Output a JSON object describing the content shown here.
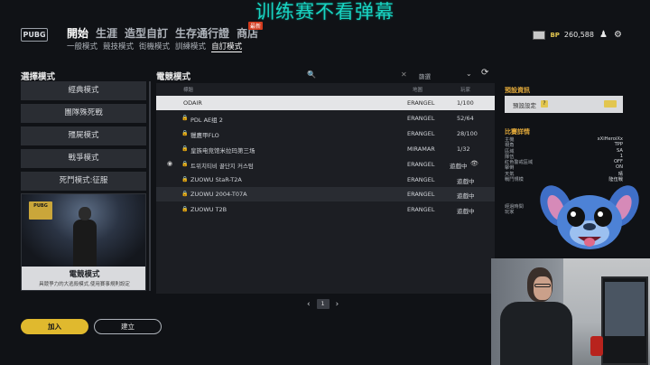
{
  "overlay": {
    "title": "训练赛不看弹幕"
  },
  "topbar": {
    "logo": "PUBG",
    "main_tabs": [
      {
        "label": "開始",
        "active": true
      },
      {
        "label": "生涯",
        "active": false
      },
      {
        "label": "造型自訂",
        "active": false
      },
      {
        "label": "生存通行證",
        "active": false
      },
      {
        "label": "商店",
        "active": false
      }
    ],
    "new_badge": "最新",
    "sub_tabs": [
      {
        "label": "一般模式",
        "active": false
      },
      {
        "label": "競技模式",
        "active": false
      },
      {
        "label": "街機模式",
        "active": false
      },
      {
        "label": "訓練模式",
        "active": false
      },
      {
        "label": "自訂模式",
        "active": true
      }
    ],
    "bp_label": "BP",
    "bp_value": "260,588"
  },
  "left": {
    "heading": "選擇模式",
    "modes": [
      "經典模式",
      "團隊殊死戰",
      "殭屍模式",
      "戰爭模式",
      "死鬥模式:征服"
    ],
    "card": {
      "badge": "PUBG",
      "title": "電競模式",
      "desc": "具競爭力的大逃殺模式,使用賽事規則設定"
    }
  },
  "middle": {
    "heading": "電競模式",
    "filter_label": "篩選",
    "columns": [
      "標題",
      "地圖",
      "玩家"
    ],
    "rows": [
      {
        "title": "ODAIR",
        "map": "ERANGEL",
        "players": "1/100",
        "locked": false,
        "style": "selected"
      },
      {
        "title": "PDL AE组 2",
        "map": "ERANGEL",
        "players": "52/64",
        "locked": true,
        "style": ""
      },
      {
        "title": "獵鷹甲FLO",
        "map": "ERANGEL",
        "players": "28/100",
        "locked": true,
        "style": ""
      },
      {
        "title": "皇族电竞馆米拉玛第三场",
        "map": "MIRAMAR",
        "players": "1/32",
        "locked": true,
        "style": ""
      },
      {
        "title": "트위치티비 꿀단지 커스텀",
        "map": "ERANGEL",
        "players": "遊戲中",
        "locked": true,
        "style": "",
        "eye": true,
        "globe": true
      },
      {
        "title": "ZUOWU StaR-T2A",
        "map": "ERANGEL",
        "players": "遊戲中",
        "locked": true,
        "style": ""
      },
      {
        "title": "ZUOWU 2004-T07A",
        "map": "ERANGEL",
        "players": "遊戲中",
        "locked": true,
        "style": "dim"
      },
      {
        "title": "ZUOWU T2B",
        "map": "ERANGEL",
        "players": "遊戲中",
        "locked": true,
        "style": ""
      }
    ],
    "pager": {
      "page": "1"
    }
  },
  "right": {
    "preset_heading": "預設資訊",
    "preset_text": "預設設定",
    "preset_help": "?",
    "details_heading": "比賽詳情",
    "details": [
      {
        "k": "主機",
        "v": "xXiHeroiXx"
      },
      {
        "k": "視角",
        "v": "TPP"
      },
      {
        "k": "區域",
        "v": "SA"
      },
      {
        "k": "隊伍",
        "v": "1"
      },
      {
        "k": "紅色警戒區域",
        "v": "OFF"
      },
      {
        "k": "擊倒",
        "v": "ON"
      },
      {
        "k": "天氣",
        "v": "晴"
      },
      {
        "k": "戰鬥規模",
        "v": "陸伍戰"
      }
    ],
    "details_2": [
      {
        "k": "經過時間"
      },
      {
        "k": "玩家"
      }
    ]
  },
  "buttons": {
    "join": "加入",
    "create": "建立"
  }
}
